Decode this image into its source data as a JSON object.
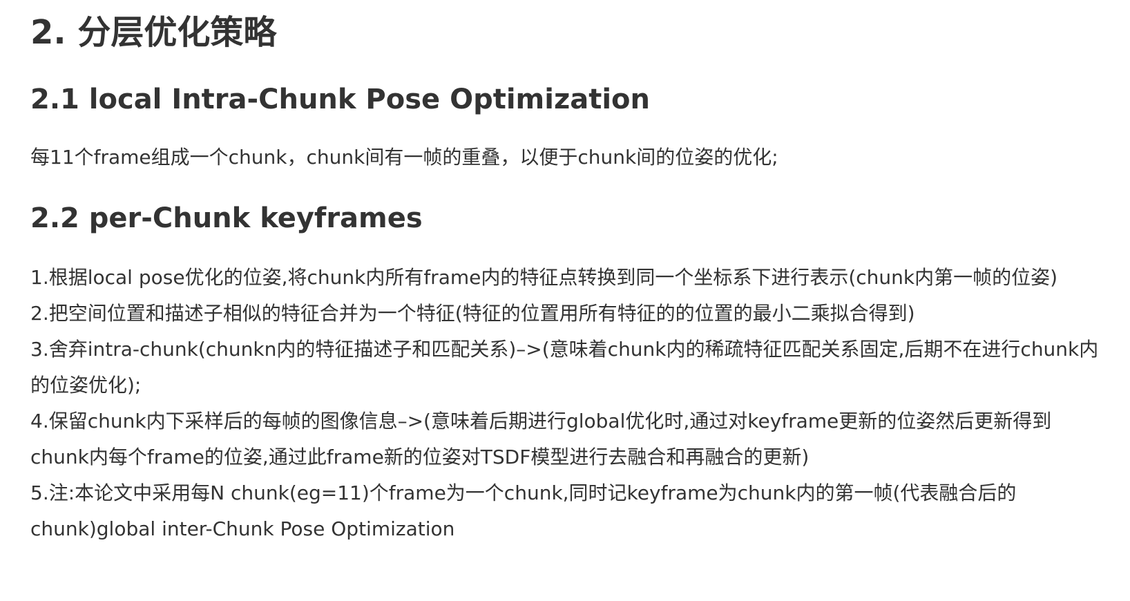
{
  "heading": "2. 分层优化策略",
  "section_1": {
    "title": "2.1 local Intra-Chunk Pose Optimization",
    "paragraph": "每11个frame组成一个chunk，chunk间有一帧的重叠，以便于chunk间的位姿的优化;"
  },
  "section_2": {
    "title": "2.2 per-Chunk keyframes",
    "items": [
      "1.根据local pose优化的位姿,将chunk内所有frame内的特征点转换到同一个坐标系下进行表示(chunk内第一帧的位姿)",
      "2.把空间位置和描述子相似的特征合并为一个特征(特征的位置用所有特征的的位置的最小二乘拟合得到)",
      "3.舍弃intra-chunk(chunkn内的特征描述子和匹配关系)–>(意味着chunk内的稀疏特征匹配关系固定,后期不在进行chunk内的位姿优化);",
      "4.保留chunk内下采样后的每帧的图像信息–>(意味着后期进行global优化时,通过对keyframe更新的位姿然后更新得到chunk内每个frame的位姿,通过此frame新的位姿对TSDF模型进行去融合和再融合的更新)",
      "5.注:本论文中采用每N chunk(eg=11)个frame为一个chunk,同时记keyframe为chunk内的第一帧(代表融合后的chunk)global inter-Chunk Pose Optimization"
    ]
  }
}
